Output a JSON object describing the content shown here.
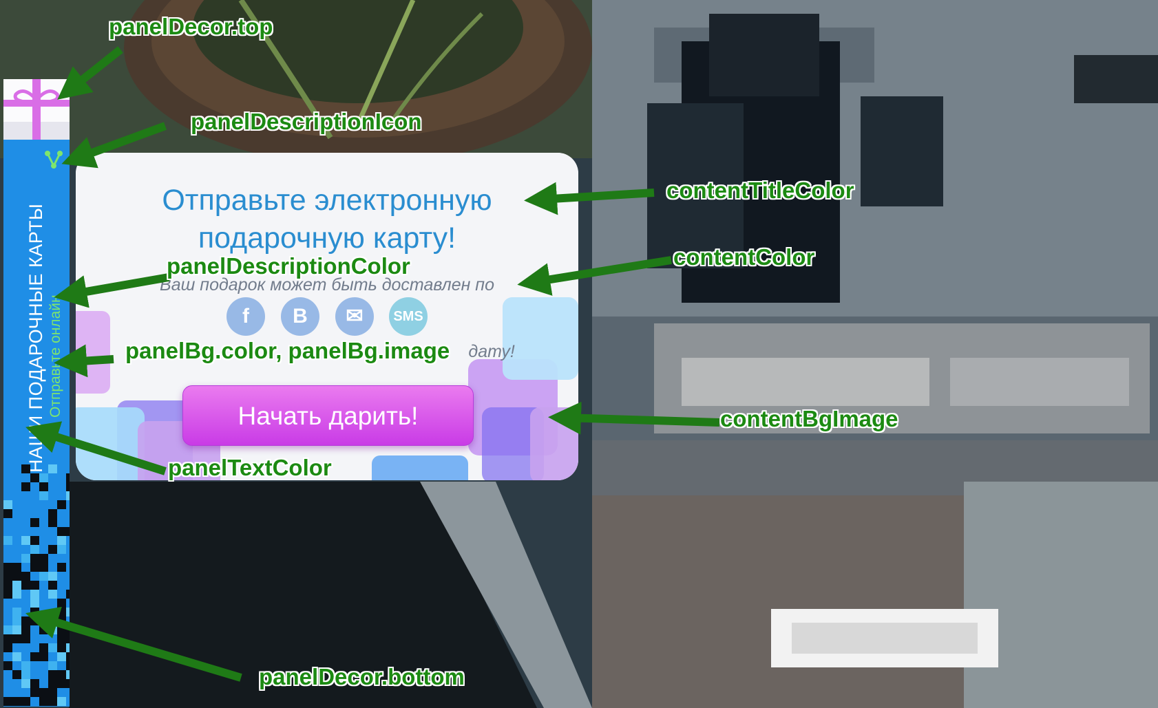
{
  "panel": {
    "title": "НАШИ ПОДАРОЧНЫЕ КАРТЫ",
    "description": "Отправьте онлайн",
    "top_decor_icon": "gift-box-icon",
    "description_icon": "share-icon"
  },
  "card": {
    "title": "Отправьте электронную подарочную карту!",
    "text": "Ваш подарок может быть доставлен по",
    "text_suffix": "дату!",
    "social": [
      {
        "label": "f",
        "icon": "facebook-icon"
      },
      {
        "label": "B",
        "icon": "vkontakte-icon"
      },
      {
        "label": "✉",
        "icon": "email-icon"
      },
      {
        "label": "SMS",
        "icon": "sms-icon"
      }
    ],
    "button_label": "Начать дарить!"
  },
  "annotations": {
    "panel_decor_top": "panelDecor.top",
    "panel_description_icon": "panelDescriptionIcon",
    "content_title_color": "contentTitleColor",
    "content_color": "contentColor",
    "panel_description_color": "panelDescriptionColor",
    "panel_bg": "panelBg.color, panelBg.image",
    "content_bg_image": "contentBgImage",
    "panel_text_color": "panelTextColor",
    "panel_decor_bottom": "panelDecor.bottom"
  },
  "colors": {
    "panel_bg": "#1f8ee6",
    "panel_text": "#ffffff",
    "panel_description": "#7fe56d",
    "content_title": "#2a8dd0",
    "content_text": "#727c8c",
    "button": "#d04ae8",
    "annotation": "#1c8a12"
  }
}
